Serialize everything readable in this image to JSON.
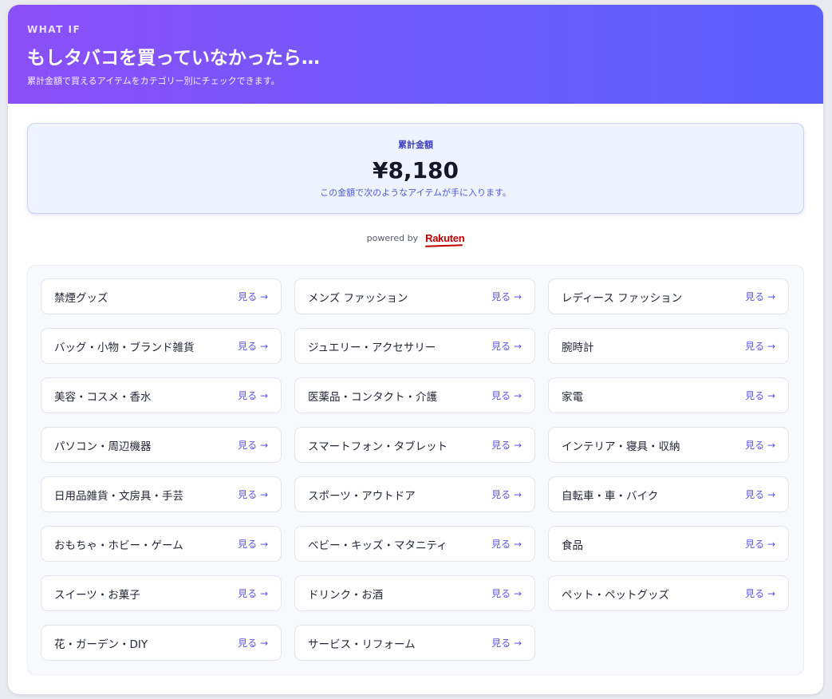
{
  "header": {
    "eyebrow": "WHAT IF",
    "title": "もしタバコを買っていなかったら…",
    "subtitle": "累計金額で買えるアイテムをカテゴリー別にチェックできます。"
  },
  "total": {
    "label": "累計金額",
    "amount": "¥8,180",
    "note": "この金額で次のようなアイテムが手に入ります。"
  },
  "powered": {
    "text": "powered by",
    "brand": "Rakuten"
  },
  "link_label": "見る →",
  "categories": [
    "禁煙グッズ",
    "メンズ ファッション",
    "レディース ファッション",
    "バッグ・小物・ブランド雑貨",
    "ジュエリー・アクセサリー",
    "腕時計",
    "美容・コスメ・香水",
    "医薬品・コンタクト・介護",
    "家電",
    "パソコン・周辺機器",
    "スマートフォン・タブレット",
    "インテリア・寝具・収納",
    "日用品雑貨・文房具・手芸",
    "スポーツ・アウトドア",
    "自転車・車・バイク",
    "おもちゃ・ホビー・ゲーム",
    "ベビー・キッズ・マタニティ",
    "食品",
    "スイーツ・お菓子",
    "ドリンク・お酒",
    "ペット・ペットグッズ",
    "花・ガーデン・DIY",
    "サービス・リフォーム"
  ],
  "colors": {
    "header_gradient_start": "#8b4ff7",
    "header_gradient_end": "#5b5ffc",
    "accent": "#5b55e6",
    "brand_red": "#bf0000"
  }
}
